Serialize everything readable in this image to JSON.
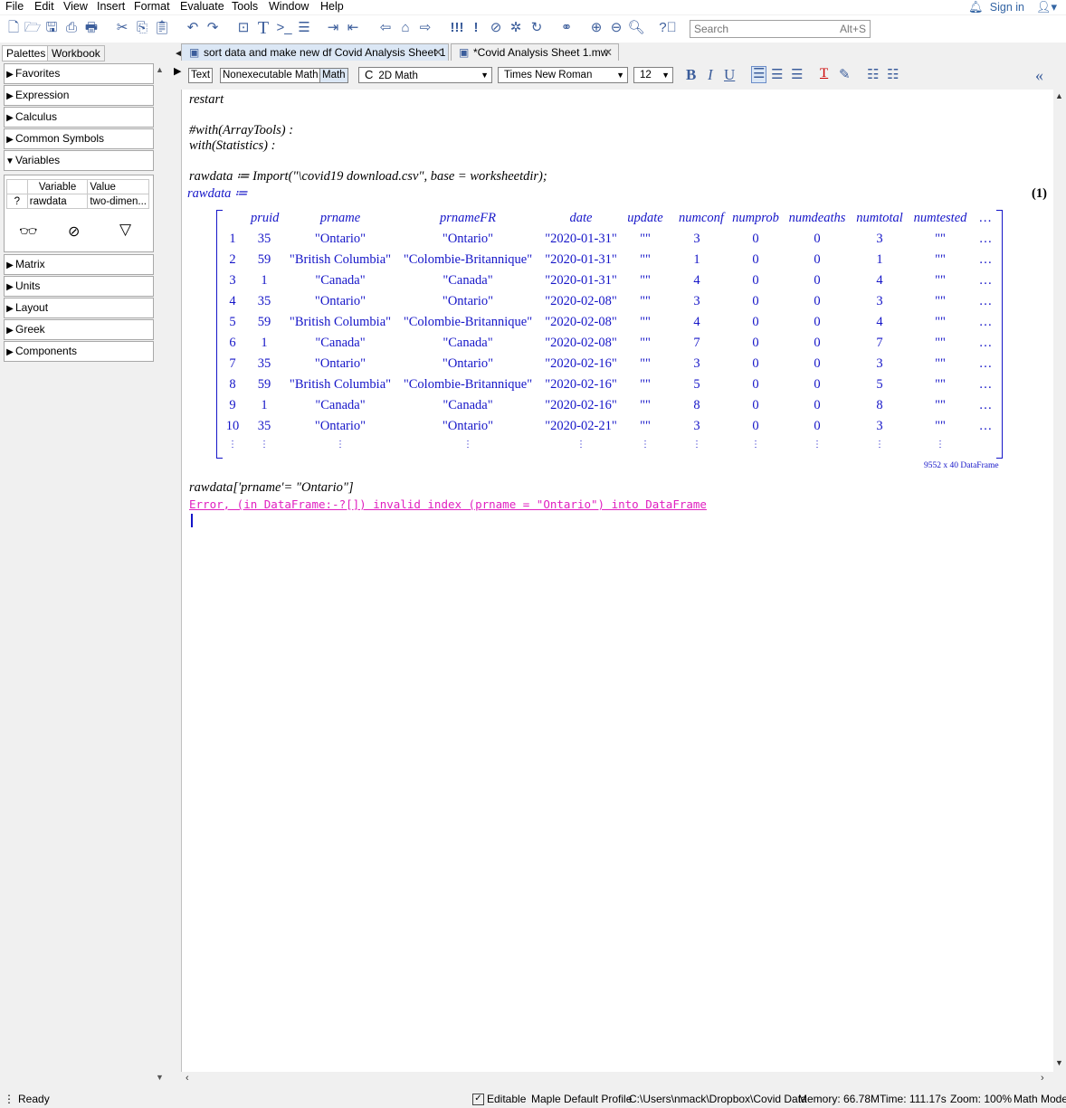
{
  "menu": [
    "File",
    "Edit",
    "View",
    "Insert",
    "Format",
    "Evaluate",
    "Tools",
    "Window",
    "Help"
  ],
  "signin": "Sign in",
  "search": {
    "placeholder": "Search",
    "hint": "Alt+S"
  },
  "palettes": {
    "tabs": [
      "Palettes",
      "Workbook"
    ],
    "sections_top": [
      "Favorites",
      "Expression",
      "Calculus",
      "Common Symbols",
      "Variables"
    ],
    "variables": {
      "headers": [
        "Variable",
        "Value"
      ],
      "rows": [
        {
          "flag": "?",
          "name": "rawdata",
          "value": "two-dimen..."
        }
      ]
    },
    "sections_bottom": [
      "Matrix",
      "Units",
      "Layout",
      "Greek",
      "Components"
    ]
  },
  "doc_tabs": [
    "sort data and make new df Covid Analysis Sheet 1",
    "*Covid Analysis Sheet 1.mw"
  ],
  "format_bar": {
    "text_btn": "Text",
    "nonexec_btn": "Nonexecutable Math",
    "math_btn": "Math",
    "mode_icon": "C",
    "mode": "2D Math",
    "font": "Times New Roman",
    "size": "12",
    "bold": "B",
    "italic": "I",
    "underline": "U"
  },
  "worksheet": {
    "line_restart": "restart",
    "line_with1": "#with(ArrayTools) :",
    "line_with2": "with(Statistics) :",
    "import_cmd": "rawdata ≔ Import(\"\\covid19 download.csv\", base = worksheetdir);",
    "output_label": "rawdata ≔",
    "eq_number": "(1)",
    "df_headers": [
      "pruid",
      "prname",
      "prnameFR",
      "date",
      "update",
      "numconf",
      "numprob",
      "numdeaths",
      "numtotal",
      "numtested",
      "…"
    ],
    "df_rows": [
      [
        "1",
        "35",
        "\"Ontario\"",
        "\"Ontario\"",
        "\"2020-01-31\"",
        "\"\"",
        "3",
        "0",
        "0",
        "3",
        "\"\"",
        "…"
      ],
      [
        "2",
        "59",
        "\"British Columbia\"",
        "\"Colombie-Britannique\"",
        "\"2020-01-31\"",
        "\"\"",
        "1",
        "0",
        "0",
        "1",
        "\"\"",
        "…"
      ],
      [
        "3",
        "1",
        "\"Canada\"",
        "\"Canada\"",
        "\"2020-01-31\"",
        "\"\"",
        "4",
        "0",
        "0",
        "4",
        "\"\"",
        "…"
      ],
      [
        "4",
        "35",
        "\"Ontario\"",
        "\"Ontario\"",
        "\"2020-02-08\"",
        "\"\"",
        "3",
        "0",
        "0",
        "3",
        "\"\"",
        "…"
      ],
      [
        "5",
        "59",
        "\"British Columbia\"",
        "\"Colombie-Britannique\"",
        "\"2020-02-08\"",
        "\"\"",
        "4",
        "0",
        "0",
        "4",
        "\"\"",
        "…"
      ],
      [
        "6",
        "1",
        "\"Canada\"",
        "\"Canada\"",
        "\"2020-02-08\"",
        "\"\"",
        "7",
        "0",
        "0",
        "7",
        "\"\"",
        "…"
      ],
      [
        "7",
        "35",
        "\"Ontario\"",
        "\"Ontario\"",
        "\"2020-02-16\"",
        "\"\"",
        "3",
        "0",
        "0",
        "3",
        "\"\"",
        "…"
      ],
      [
        "8",
        "59",
        "\"British Columbia\"",
        "\"Colombie-Britannique\"",
        "\"2020-02-16\"",
        "\"\"",
        "5",
        "0",
        "0",
        "5",
        "\"\"",
        "…"
      ],
      [
        "9",
        "1",
        "\"Canada\"",
        "\"Canada\"",
        "\"2020-02-16\"",
        "\"\"",
        "8",
        "0",
        "0",
        "8",
        "\"\"",
        "…"
      ],
      [
        "10",
        "35",
        "\"Ontario\"",
        "\"Ontario\"",
        "\"2020-02-21\"",
        "\"\"",
        "3",
        "0",
        "0",
        "3",
        "\"\"",
        "…"
      ],
      [
        "⋮",
        "⋮",
        "⋮",
        "⋮",
        "⋮",
        "⋮",
        "⋮",
        "⋮",
        "⋮",
        "⋮",
        "⋮",
        ""
      ]
    ],
    "df_size": "9552 x 40 DataFrame",
    "index_cmd": "rawdata['prname'= \"Ontario\"]",
    "error": "Error, (in DataFrame:-?[]) invalid index (prname = \"Ontario\") into DataFrame"
  },
  "status": {
    "ready": "Ready",
    "editable": "Editable",
    "profile": "Maple Default Profile",
    "path": "C:\\Users\\nmack\\Dropbox\\Covid Data",
    "memory": "Memory: 66.78M",
    "time": "Time: 111.17s",
    "zoom": "Zoom: 100%",
    "mode": "Math Mode"
  }
}
